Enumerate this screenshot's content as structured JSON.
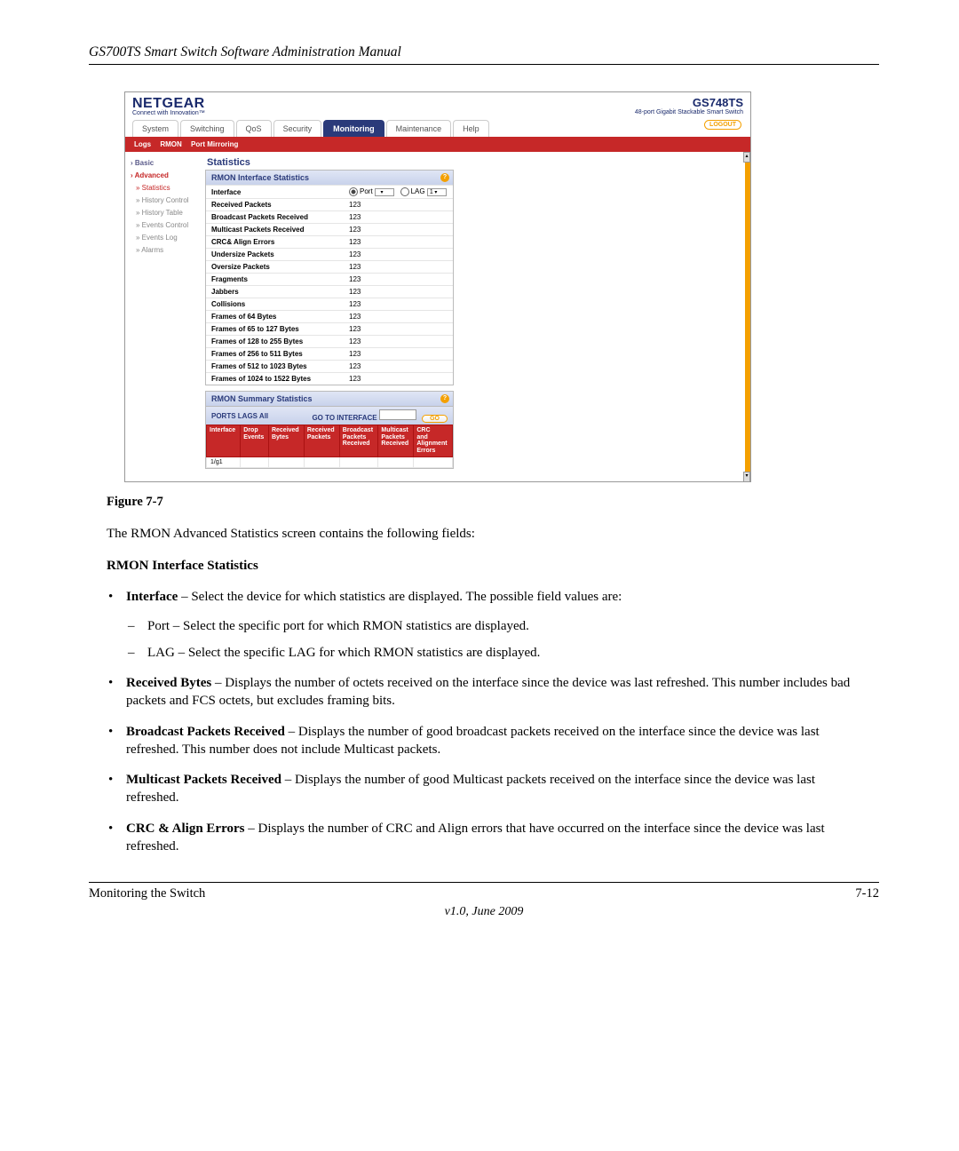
{
  "header": {
    "title": "GS700TS Smart Switch Software Administration Manual"
  },
  "screenshot": {
    "brand": {
      "logo": "NETGEAR",
      "tagline": "Connect with Innovation™"
    },
    "product": {
      "model": "GS748TS",
      "desc": "48-port Gigabit Stackable Smart Switch"
    },
    "tabs": [
      "System",
      "Switching",
      "QoS",
      "Security",
      "Monitoring",
      "Maintenance",
      "Help"
    ],
    "active_tab": "Monitoring",
    "logout": "LOGOUT",
    "subnav": [
      "Logs",
      "RMON",
      "Port Mirroring"
    ],
    "sidebar": {
      "items": [
        {
          "label": "Basic",
          "cls": "lvl1"
        },
        {
          "label": "Advanced",
          "cls": "lvl1 sel"
        },
        {
          "label": "Statistics",
          "cls": "lvl2"
        },
        {
          "label": "History Control",
          "cls": "lvl3"
        },
        {
          "label": "History Table",
          "cls": "lvl3"
        },
        {
          "label": "Events Control",
          "cls": "lvl3"
        },
        {
          "label": "Events Log",
          "cls": "lvl3"
        },
        {
          "label": "Alarms",
          "cls": "lvl3"
        }
      ]
    },
    "panel_title": "Statistics",
    "interface_panel": {
      "heading": "RMON Interface Statistics",
      "interface_label": "Interface",
      "port_label": "Port",
      "lag_label": "LAG",
      "lag_value": "1",
      "rows": [
        {
          "label": "Received Packets",
          "value": "123"
        },
        {
          "label": "Broadcast Packets Received",
          "value": "123"
        },
        {
          "label": "Multicast Packets Received",
          "value": "123"
        },
        {
          "label": "CRC& Align Errors",
          "value": "123"
        },
        {
          "label": "Undersize Packets",
          "value": "123"
        },
        {
          "label": "Oversize Packets",
          "value": "123"
        },
        {
          "label": "Fragments",
          "value": "123"
        },
        {
          "label": "Jabbers",
          "value": "123"
        },
        {
          "label": "Collisions",
          "value": "123"
        },
        {
          "label": "Frames of 64 Bytes",
          "value": "123"
        },
        {
          "label": "Frames of 65 to 127 Bytes",
          "value": "123"
        },
        {
          "label": "Frames of 128 to 255 Bytes",
          "value": "123"
        },
        {
          "label": "Frames of 256 to 511 Bytes",
          "value": "123"
        },
        {
          "label": "Frames of 512 to 1023 Bytes",
          "value": "123"
        },
        {
          "label": "Frames of 1024 to 1522 Bytes",
          "value": "123"
        }
      ]
    },
    "summary_panel": {
      "heading": "RMON Summary Statistics",
      "ports_label": "PORTS LAGS All",
      "goto_label": "GO TO INTERFACE",
      "go_button": "GO",
      "columns": [
        "Interface",
        "Drop Events",
        "Received Bytes",
        "Received Packets",
        "Broadcast Packets Received",
        "Multicast Packets Received",
        "CRC and Alignment Errors"
      ],
      "row0": "1/g1"
    }
  },
  "figure_caption": "Figure 7-7",
  "intro": "The RMON Advanced Statistics screen contains the following fields:",
  "section_heading": "RMON Interface Statistics",
  "bullets": [
    {
      "strong": "Interface",
      "rest": " – Select the device for which statistics are displayed. The possible field values are:",
      "subs": [
        "Port – Select the specific port for which RMON statistics are displayed.",
        "LAG – Select the specific LAG for which RMON statistics are displayed."
      ]
    },
    {
      "strong": "Received Bytes",
      "rest": " – Displays the number of octets received on the interface since the device was last refreshed. This number includes bad packets and FCS octets, but excludes framing bits."
    },
    {
      "strong": "Broadcast Packets Received",
      "rest": " – Displays the number of good broadcast packets received on the interface since the device was last refreshed. This number does not include Multicast packets."
    },
    {
      "strong": "Multicast Packets Received",
      "rest": " – Displays the number of good Multicast packets received on the interface since the device was last refreshed."
    },
    {
      "strong": "CRC & Align Errors",
      "rest": " – Displays the number of CRC and Align errors that have occurred on the interface since the device was last refreshed."
    }
  ],
  "footer": {
    "left": "Monitoring the Switch",
    "right": "7-12",
    "version": "v1.0, June 2009"
  }
}
